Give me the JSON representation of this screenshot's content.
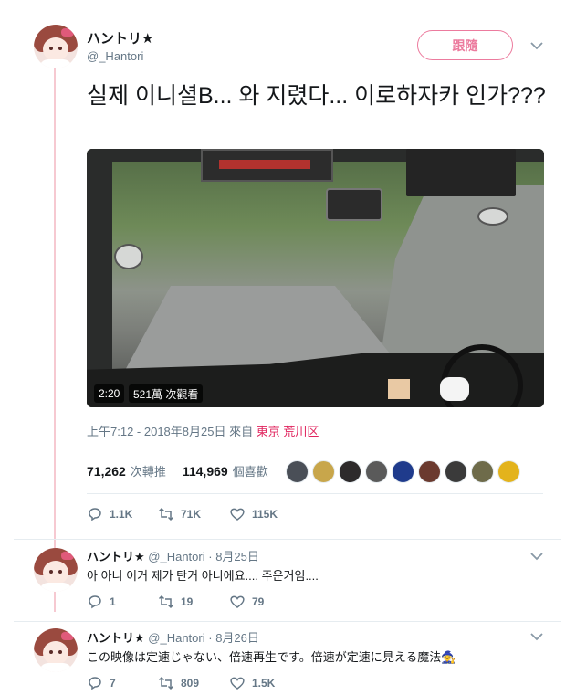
{
  "main_tweet": {
    "display_name": "ハントリ★",
    "handle": "@_Hantori",
    "follow_label": "跟隨",
    "text": "실제 이니셜B... 와 지렸다... 이로하자카 인가???",
    "video": {
      "duration": "2:20",
      "views": "521萬 次觀看"
    },
    "meta_time": "上午7:12 - 2018年8月25日 來自",
    "meta_place": "東京 荒川区",
    "retweet_count": "71,262",
    "retweet_label": "次轉推",
    "like_count": "114,969",
    "like_label": "個喜歡",
    "actions": {
      "replies": "1.1K",
      "retweets": "71K",
      "likes": "115K"
    }
  },
  "likers": [
    "avatar-1",
    "avatar-2",
    "avatar-3",
    "avatar-4",
    "avatar-5",
    "avatar-6",
    "avatar-7",
    "avatar-8",
    "avatar-9"
  ],
  "replies": [
    {
      "display_name": "ハントリ★",
      "handle": "@_Hantori",
      "date": "· 8月25日",
      "text": "아 아니 이거 제가 탄거 아니에요.... 주운거임....",
      "actions": {
        "replies": "1",
        "retweets": "19",
        "likes": "79"
      }
    },
    {
      "display_name": "ハントリ★",
      "handle": "@_Hantori",
      "date": "· 8月26日",
      "text": "この映像は定速じゃない、倍速再生です。倍速が定速に見える魔法🧙",
      "actions": {
        "replies": "7",
        "retweets": "809",
        "likes": "1.5K"
      }
    }
  ],
  "colors": {
    "accent": "#e0245e",
    "thread_line": "#f6c9d1",
    "muted": "#657786"
  }
}
